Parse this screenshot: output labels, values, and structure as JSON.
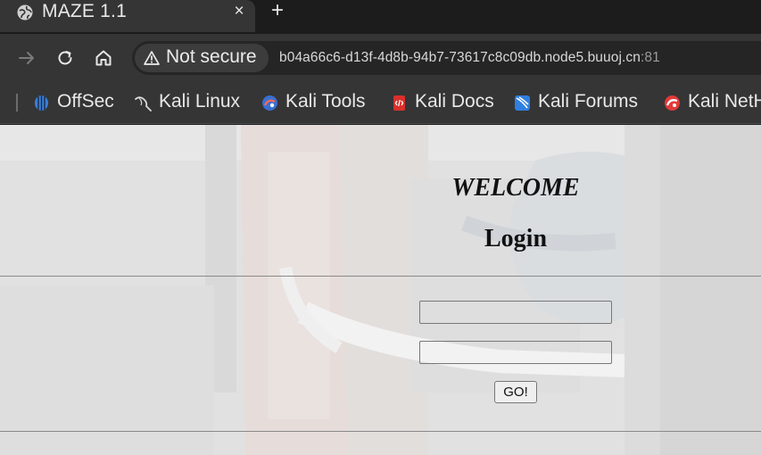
{
  "browser": {
    "tab": {
      "title": "MAZE 1.1",
      "close_symbol": "×",
      "favicon": "globe-icon"
    },
    "new_tab_symbol": "+",
    "toolbar": {
      "security_label": "Not secure",
      "url_host": "b04a66c6-d13f-4d8b-94b7-73617c8c09db.node5.buuoj.cn",
      "url_port": ":81"
    },
    "bookmarks": [
      {
        "label": "OffSec",
        "icon": "offsec-icon"
      },
      {
        "label": "Kali Linux",
        "icon": "kali-linux-icon"
      },
      {
        "label": "Kali Tools",
        "icon": "kali-tools-icon"
      },
      {
        "label": "Kali Docs",
        "icon": "kali-docs-icon"
      },
      {
        "label": "Kali Forums",
        "icon": "kali-forums-icon"
      },
      {
        "label": "Kali NetHunter",
        "icon": "kali-nethunter-icon"
      }
    ]
  },
  "page": {
    "welcome": "WELCOME",
    "heading": "Login",
    "form": {
      "username_value": "",
      "password_value": "",
      "submit_label": "GO!"
    }
  },
  "colors": {
    "chrome_dark": "#1c1c1c",
    "chrome_toolbar": "#353535",
    "page_background": "#e6e6e6"
  }
}
